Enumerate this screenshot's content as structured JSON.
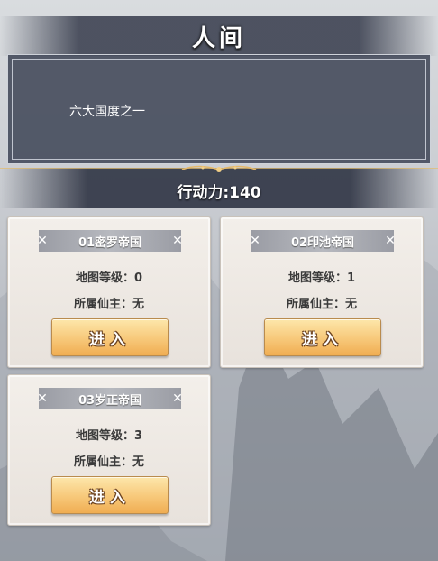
{
  "header": {
    "title": "人间"
  },
  "description": {
    "text": "六大国度之一"
  },
  "energy": {
    "label": "行动力:140"
  },
  "kingdoms": [
    {
      "name": "01密罗帝国",
      "map_level": "地图等级：0",
      "owner": "所属仙主：无",
      "enter_label": "进入"
    },
    {
      "name": "02印池帝国",
      "map_level": "地图等级：1",
      "owner": "所属仙主：无",
      "enter_label": "进入"
    },
    {
      "name": "03岁正帝国",
      "map_level": "地图等级：3",
      "owner": "所属仙主：无",
      "enter_label": "进入"
    }
  ],
  "colors": {
    "panel": "#484e5e",
    "button": "#f7c879",
    "card": "#f3efea"
  }
}
